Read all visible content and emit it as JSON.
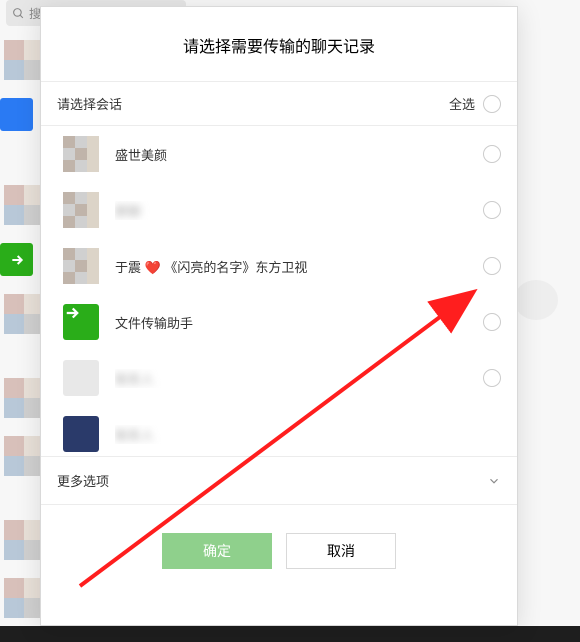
{
  "background": {
    "search_placeholder": "搜索",
    "plus": "+"
  },
  "dialog": {
    "title": "请选择需要传输的聊天记录",
    "select_session_label": "请选择会话",
    "select_all_label": "全选",
    "conversations": [
      {
        "name": "盛世美颜",
        "avatar_type": "grid"
      },
      {
        "name": "群聊",
        "avatar_type": "grid",
        "blurred": true
      },
      {
        "name": "于震 ❤️ 《闪亮的名字》东方卫视",
        "avatar_type": "grid"
      },
      {
        "name": "文件传输助手",
        "avatar_type": "green"
      },
      {
        "name": "联系人",
        "avatar_type": "single",
        "blurred": true
      },
      {
        "name": "联系人",
        "avatar_type": "single",
        "blurred": true,
        "partial": true
      }
    ],
    "more_options_label": "更多选项",
    "confirm_label": "确定",
    "cancel_label": "取消"
  }
}
